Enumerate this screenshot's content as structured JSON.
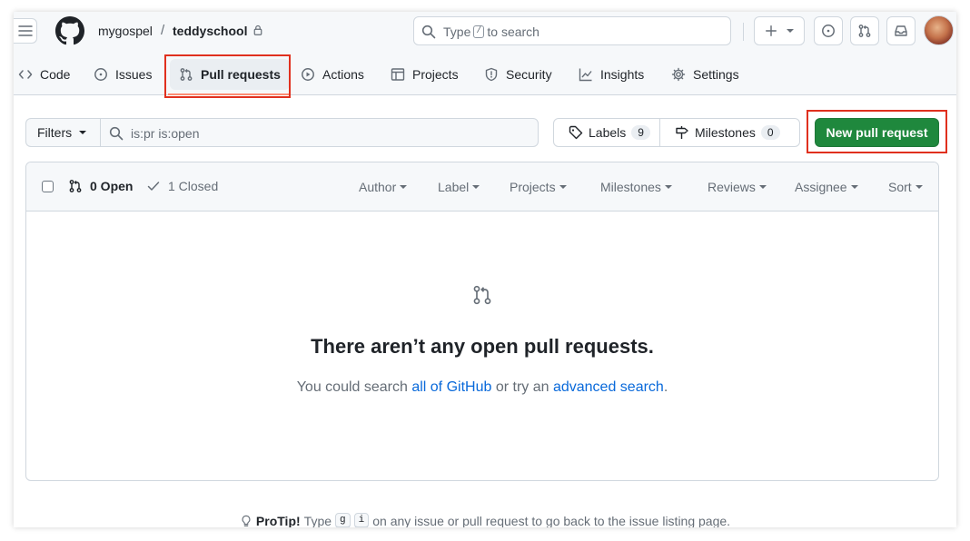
{
  "header": {
    "owner": "mygospel",
    "separator": "/",
    "repo": "teddyschool",
    "search_prefix": "Type",
    "search_key": "/",
    "search_suffix": "to search"
  },
  "tabs": [
    {
      "label": "Code",
      "icon": "code-icon"
    },
    {
      "label": "Issues",
      "icon": "issue-opened-icon"
    },
    {
      "label": "Pull requests",
      "icon": "git-pull-request-icon",
      "active": true
    },
    {
      "label": "Actions",
      "icon": "play-icon"
    },
    {
      "label": "Projects",
      "icon": "table-icon"
    },
    {
      "label": "Security",
      "icon": "shield-icon"
    },
    {
      "label": "Insights",
      "icon": "graph-icon"
    },
    {
      "label": "Settings",
      "icon": "gear-icon"
    }
  ],
  "toolbar": {
    "filters_label": "Filters",
    "filter_query": "is:pr is:open",
    "labels_label": "Labels",
    "labels_count": "9",
    "milestones_label": "Milestones",
    "milestones_count": "0",
    "new_pr_label": "New pull request"
  },
  "list": {
    "open_label": "0 Open",
    "closed_label": "1 Closed",
    "filters": [
      "Author",
      "Label",
      "Projects",
      "Milestones",
      "Reviews",
      "Assignee",
      "Sort"
    ]
  },
  "blankslate": {
    "title": "There aren’t any open pull requests.",
    "text_before": "You could search ",
    "link1": "all of GitHub",
    "text_middle": " or try an ",
    "link2": "advanced search",
    "text_after": "."
  },
  "protip": {
    "label": "ProTip!",
    "text1": "Type",
    "key1": "g",
    "key2": "i",
    "text2": "on any issue or pull request to go back to the issue listing page."
  },
  "colors": {
    "accent_green": "#1f883d",
    "link_blue": "#0969da",
    "highlight_red": "#e0301e",
    "tab_underline": "#fd8c73"
  }
}
